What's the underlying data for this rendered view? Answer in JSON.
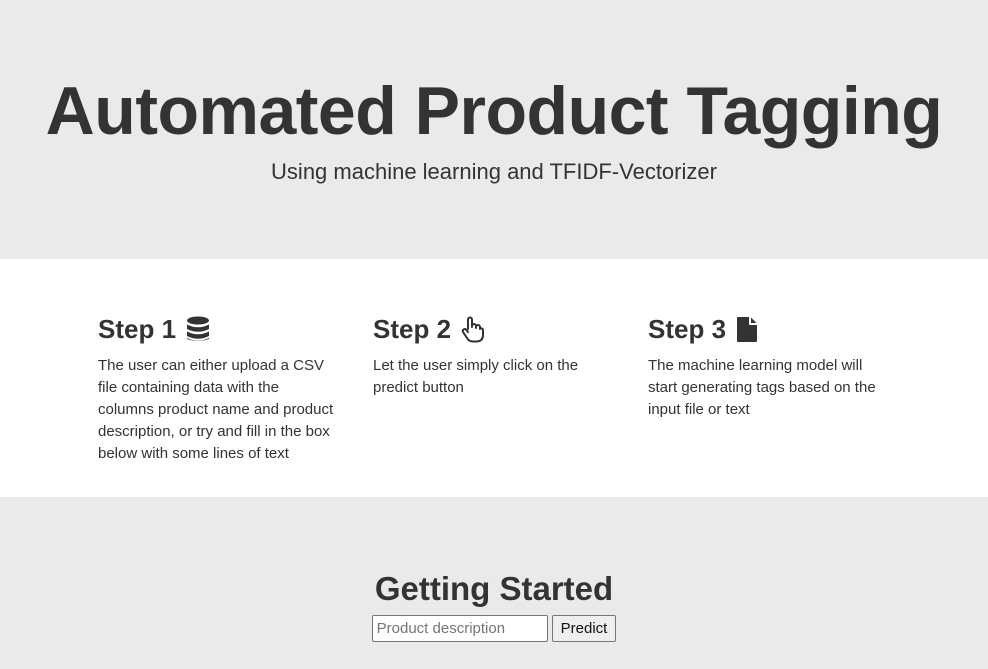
{
  "hero": {
    "title": "Automated Product Tagging",
    "subtitle": "Using machine learning and TFIDF-Vectorizer"
  },
  "steps": [
    {
      "title": "Step 1",
      "icon": "database-icon",
      "text": "The user can either upload a CSV file containing data with the columns product name and product description, or try and fill in the box below with some lines of text"
    },
    {
      "title": "Step 2",
      "icon": "hand-pointer-icon",
      "text": "Let the user simply click on the predict button"
    },
    {
      "title": "Step 3",
      "icon": "file-icon",
      "text": "The machine learning model will start generating tags based on the input file or text"
    }
  ],
  "getting_started": {
    "heading": "Getting Started",
    "input_placeholder": "Product description",
    "input_value": "",
    "predict_label": "Predict"
  },
  "colors": {
    "background_gray": "#eaeaea",
    "background_white": "#ffffff",
    "text": "#333333"
  }
}
